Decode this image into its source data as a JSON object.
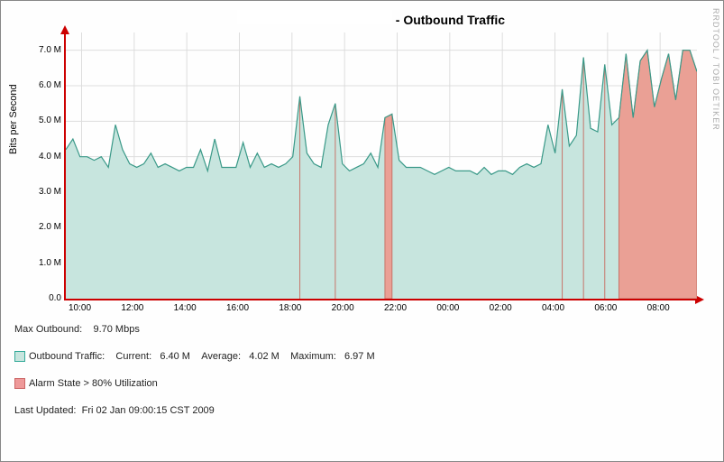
{
  "title_suffix": " - Outbound Traffic",
  "side_credit": "RRDTOOL / TOBI OETIKER",
  "ylabel": "Bits per Second",
  "max_outbound_label": "Max Outbound:",
  "max_outbound_value": "9.70 Mbps",
  "legend_traffic": "Outbound Traffic:",
  "current_label": "Current:",
  "current_value": "6.40 M",
  "average_label": "Average:",
  "average_value": "4.02 M",
  "maximum_label": "Maximum:",
  "maximum_value": "6.97 M",
  "legend_alarm": "Alarm State > 80% Utilization",
  "last_updated_label": "Last Updated:",
  "last_updated_value": "Fri 02 Jan 09:00:15 CST 2009",
  "chart_data": {
    "type": "area",
    "title": " - Outbound Traffic",
    "xlabel": "",
    "ylabel": "Bits per Second",
    "ylim": [
      0,
      7.5
    ],
    "yticks": [
      0.0,
      1.0,
      2.0,
      3.0,
      4.0,
      5.0,
      6.0,
      7.0
    ],
    "ytick_labels": [
      "0.0",
      "1.0 M",
      "2.0 M",
      "3.0 M",
      "4.0 M",
      "5.0 M",
      "6.0 M",
      "7.0 M"
    ],
    "xtick_labels": [
      "10:00",
      "12:00",
      "14:00",
      "16:00",
      "18:00",
      "20:00",
      "22:00",
      "00:00",
      "02:00",
      "04:00",
      "06:00",
      "08:00"
    ],
    "x_range_hours": 24,
    "series": [
      {
        "name": "Outbound Traffic",
        "color_fill": "#c7e5de",
        "color_line": "#3a9988",
        "values": [
          4.2,
          4.5,
          4.0,
          4.0,
          3.9,
          4.0,
          3.7,
          4.9,
          4.2,
          3.8,
          3.7,
          3.8,
          4.1,
          3.7,
          3.8,
          3.7,
          3.6,
          3.7,
          3.7,
          4.2,
          3.6,
          4.5,
          3.7,
          3.7,
          3.7,
          4.4,
          3.7,
          4.1,
          3.7,
          3.8,
          3.7,
          3.8,
          4.0,
          5.7,
          4.1,
          3.8,
          3.7,
          4.9,
          5.5,
          3.8,
          3.6,
          3.7,
          3.8,
          4.1,
          3.7,
          5.1,
          5.2,
          3.9,
          3.7,
          3.7,
          3.7,
          3.6,
          3.5,
          3.6,
          3.7,
          3.6,
          3.6,
          3.6,
          3.5,
          3.7,
          3.5,
          3.6,
          3.6,
          3.5,
          3.7,
          3.8,
          3.7,
          3.8,
          4.9,
          4.1,
          5.9,
          4.3,
          4.6,
          6.8,
          4.8,
          4.7,
          6.6,
          4.9,
          5.1,
          6.9,
          5.1,
          6.7,
          7.0,
          5.4,
          6.2,
          6.9,
          5.6,
          7.0,
          7.0,
          6.4
        ]
      },
      {
        "name": "Alarm State > 80% Utilization",
        "color_fill": "#eaa095",
        "color_line": "#c7766b",
        "mask_over": 5.0
      }
    ],
    "stats": {
      "current": 6.4,
      "average": 4.02,
      "maximum": 6.97,
      "max_outbound_mbps": 9.7
    }
  }
}
